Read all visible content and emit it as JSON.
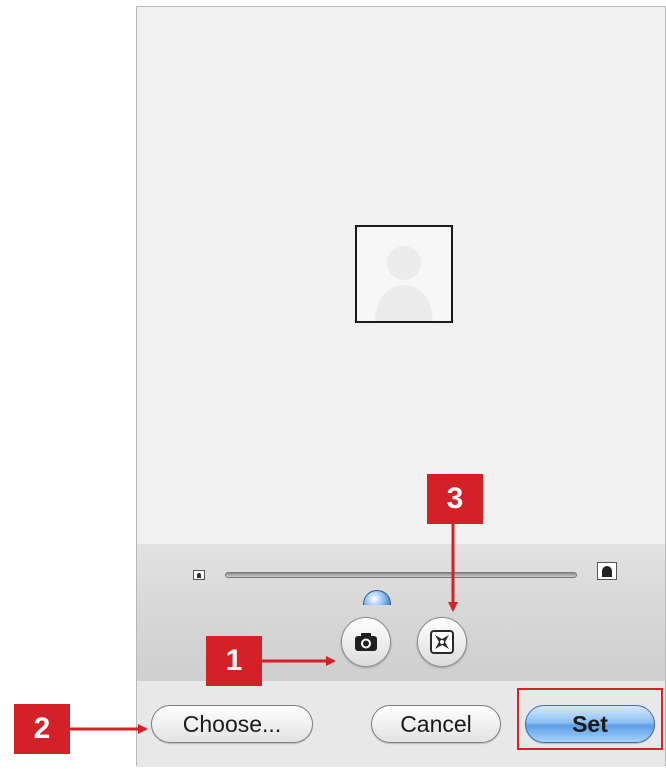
{
  "dialog": {
    "zoom": {
      "level": 0.43
    },
    "buttons": {
      "choose_label": "Choose...",
      "cancel_label": "Cancel",
      "set_label": "Set"
    }
  },
  "annotations": {
    "callout_1": "1",
    "callout_2": "2",
    "callout_3": "3"
  },
  "colors": {
    "callout": "#d42027",
    "default_button": "#5b9ee6",
    "slider_thumb": "#3f86d8"
  },
  "icons": {
    "photo_placeholder": "person-silhouette-icon",
    "zoom_small": "small-person-icon",
    "zoom_large": "large-person-icon",
    "camera": "camera-icon",
    "effects": "effects-icon"
  }
}
